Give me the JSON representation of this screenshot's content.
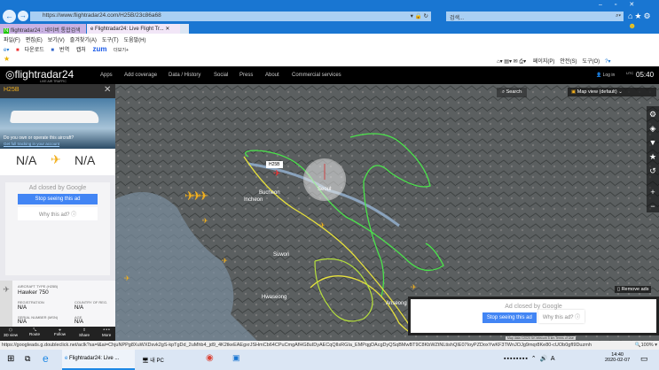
{
  "browser": {
    "url": "https://www.flightradar24.com/H25B/23c86a68",
    "search_placeholder": "검색...",
    "tabs": [
      {
        "label": "flightradar24 : 네이버 통합검색"
      },
      {
        "label": "Flightradar24: Live Flight Tr..."
      }
    ],
    "menu": [
      "파일(F)",
      "편집(E)",
      "보기(V)",
      "즐겨찾기(A)",
      "도구(T)",
      "도움말(H)"
    ],
    "favorites": [
      "다운로드",
      "번역",
      "캡처",
      "zum",
      "더보기+"
    ],
    "commandbar": [
      "페이지(P)",
      "안전(S)",
      "도구(O)"
    ],
    "status_url": "https://googleads.g.doubleclick.net/aclk?sa=l&ai=ChjuNPPg8XuWXDsvk2gS-kpTgDd_2uMhb4_jd9_4K2tkeEAEgxrJSHmCb64CPuCmgAfHG8uIDyAECqQIlsRGIa_EMPqgDAcgDyQSqBMwBT9C8KbWZtNLtishQIE07IoyPZDoxYwKF3TWnJOJg9mqr8Ke80-cUOb0gfI9Duzmh",
    "zoom": "100%"
  },
  "fr24": {
    "logo": "flightradar24",
    "logo_sub": "LIVE AIR TRAFFIC",
    "nav": [
      "Apps",
      "Add coverage",
      "Data / History",
      "Social",
      "Press",
      "About",
      "Commercial services"
    ],
    "login": "Log in",
    "utc_label": "UTC",
    "time": "05:40"
  },
  "panel": {
    "callsign": "H25B",
    "promo_title": "Do you own or operate this aircraft?",
    "promo_link": "Get full tracking in your account",
    "origin": "N/A",
    "destination": "N/A",
    "ad": {
      "closed": "Ad closed by Google",
      "stop": "Stop seeing this ad",
      "why": "Why this ad? ⓘ"
    },
    "aircraft_type_label": "AIRCRAFT TYPE",
    "aircraft_type_code": "(H25B)",
    "aircraft_type": "Hawker 750",
    "registration_label": "REGISTRATION",
    "registration": "N/A",
    "country_label": "COUNTRY OF REG.",
    "country": "N/A",
    "serial_label": "SERIAL NUMBER (MSN)",
    "serial": "N/A",
    "age_label": "AGE",
    "age": "N/A",
    "actions": [
      "3D view",
      "Route",
      "Follow",
      "Share",
      "More"
    ]
  },
  "map": {
    "search": "Search",
    "view": "Map view (default)",
    "aircraft_label": "H25B",
    "city_labels": [
      "Bucheon",
      "Incheon",
      "Seoul",
      "Suwon",
      "Anseong",
      "Hwaseong"
    ],
    "remove_ads": "Remove ads",
    "attribution": "Map data ©2020 SK telecom   5 km   Terms of Use",
    "ad": {
      "closed": "Ad closed by Google",
      "stop": "Stop seeing this ad",
      "why": "Why this ad? ⓘ"
    }
  },
  "taskbar": {
    "app": "Flightradar24: Live ...",
    "pc": "내 PC",
    "time": "14:40",
    "date": "2020-02-07"
  },
  "colors": {
    "track_green": "#4be34b",
    "track_yellow": "#e8e23c",
    "aircraft": "#f2b01e",
    "fr24_bg": "#000000",
    "ie_blue": "#1976d2"
  }
}
